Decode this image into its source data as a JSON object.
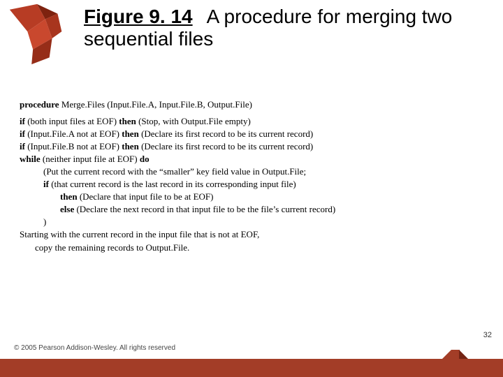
{
  "title": {
    "label": "Figure 9. 14",
    "text": "A procedure for merging two sequential files"
  },
  "code": {
    "l1a": "procedure",
    "l1b": " Merge.Files (Input.File.A, Input.File.B, Output.File)",
    "l2a": "if",
    "l2b": " (both input files at EOF) ",
    "l2c": "then",
    "l2d": " (Stop, with Output.File empty)",
    "l3a": "if",
    "l3b": " (Input.File.A not at EOF) ",
    "l3c": "then",
    "l3d": " (Declare its first record to be its current record)",
    "l4a": "if",
    "l4b": " (Input.File.B not at EOF) ",
    "l4c": "then",
    "l4d": " (Declare its first record to be its current record)",
    "l5a": "while",
    "l5b": " (neither input file at EOF) ",
    "l5c": "do",
    "l6": "(Put the current record with the  “smaller”  key field value in Output.File;",
    "l7a": "if",
    "l7b": " (that current record is the last record in its corresponding input file)",
    "l8a": "then",
    "l8b": " (Declare that input file to be at EOF)",
    "l9a": "else",
    "l9b": " (Declare the next record in that input file to be the file’s current record)",
    "l10": ")",
    "l11": "Starting with the current record in the input file that is not at EOF,",
    "l12": "copy the remaining records to Output.File."
  },
  "footer": {
    "copyright": "© 2005 Pearson Addison-Wesley. All rights reserved",
    "page": "32"
  }
}
